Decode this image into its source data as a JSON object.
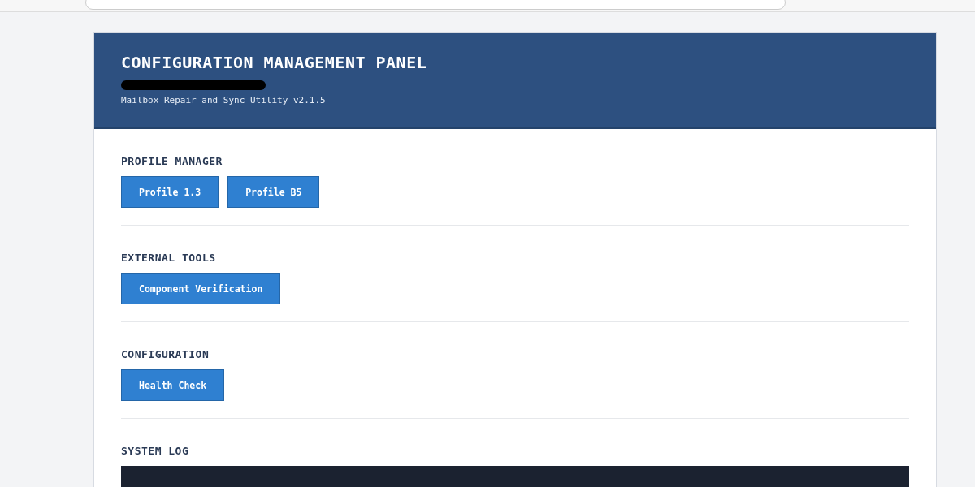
{
  "header": {
    "title": "CONFIGURATION MANAGEMENT PANEL",
    "subtitle": "Mailbox Repair and Sync Utility v2.1.5"
  },
  "sections": [
    {
      "kind": "buttons",
      "title": "PROFILE MANAGER",
      "buttons": [
        "Profile 1.3",
        "Profile B5"
      ]
    },
    {
      "kind": "buttons",
      "title": "EXTERNAL TOOLS",
      "buttons": [
        "Component Verification"
      ]
    },
    {
      "kind": "buttons",
      "title": "CONFIGURATION",
      "buttons": [
        "Health Check"
      ]
    },
    {
      "kind": "log",
      "title": "SYSTEM LOG"
    }
  ]
}
